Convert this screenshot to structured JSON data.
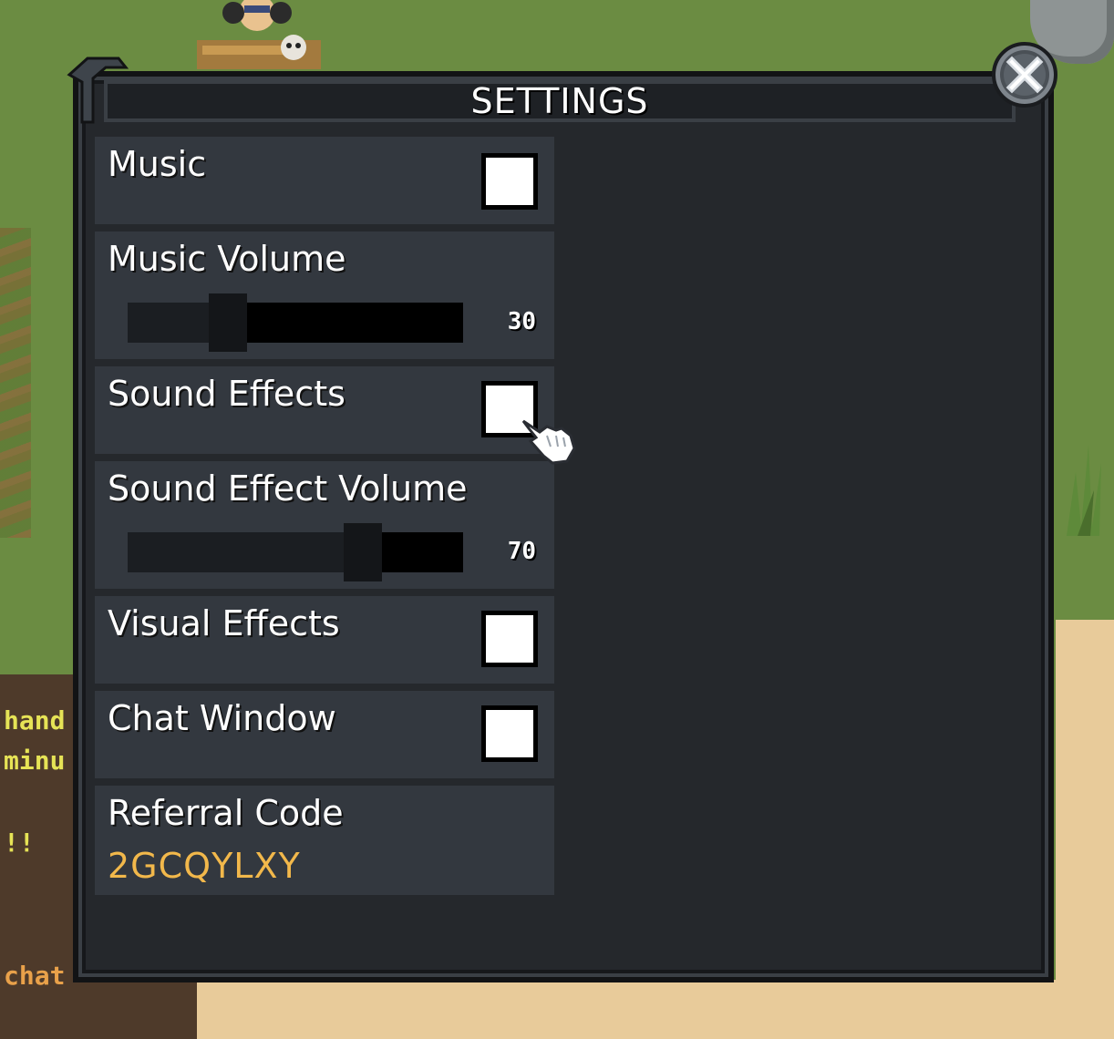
{
  "window": {
    "title": "SETTINGS",
    "close_icon": "close-x-icon"
  },
  "settings": {
    "music": {
      "label": "Music",
      "checked": false
    },
    "music_volume": {
      "label": "Music Volume",
      "value": "30",
      "level": 30
    },
    "sound_effects": {
      "label": "Sound Effects",
      "checked": false
    },
    "sound_effect_volume": {
      "label": "Sound Effect Volume",
      "value": "70",
      "level": 70
    },
    "visual_effects": {
      "label": "Visual Effects",
      "checked": false
    },
    "chat_window": {
      "label": "Chat Window",
      "checked": false
    },
    "referral": {
      "label": "Referral Code",
      "code": "2GCQYLXY"
    }
  },
  "background_chat": {
    "lines": [
      "hand",
      "minu",
      "!!",
      "chat"
    ]
  },
  "colors": {
    "panel": "#25282c",
    "row": "#33383f",
    "referral_code": "#f2b84b",
    "grass": "#6b8c42",
    "sand": "#e8cb9a"
  }
}
